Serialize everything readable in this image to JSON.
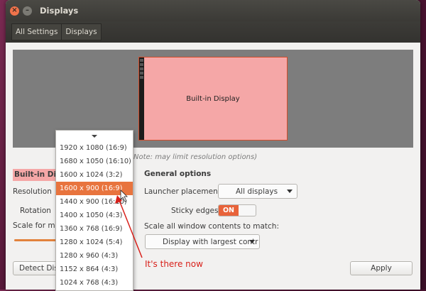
{
  "window": {
    "title": "Displays",
    "close_icon": "close-icon",
    "minimize_icon": "minimize-icon"
  },
  "toolbar": {
    "all_settings": "All Settings",
    "displays": "Displays"
  },
  "preview": {
    "monitor_label": "Built-in Display"
  },
  "note": "Note: may limit resolution options)",
  "left": {
    "display_name": "Built-in Display",
    "resolution_label": "Resolution",
    "rotation_label": "Rotation",
    "scale_label": "Scale for menu and title bars:",
    "detect_button": "Detect Displays"
  },
  "resolution_dropdown": {
    "options": [
      "1920 x 1080 (16:9)",
      "1680 x 1050 (16:10)",
      "1600 x 1024 (3:2)",
      "1600 x 900 (16:9)",
      "1440 x 900 (16:10)",
      "1400 x 1050 (4:3)",
      "1360 x 768 (16:9)",
      "1280 x 1024 (5:4)",
      "1280 x 960 (4:3)",
      "1152 x 864 (4:3)",
      "1024 x 768 (4:3)"
    ],
    "selected": "1600 x 900 (16:9)"
  },
  "general": {
    "title": "General options",
    "launcher_label": "Launcher placement",
    "launcher_value": "All displays",
    "sticky_label": "Sticky edges",
    "sticky_value": "ON",
    "scale_all_label": "Scale all window contents to match:",
    "scale_all_value": "Display with largest contr"
  },
  "apply_button": "Apply",
  "annotation": "It's there now",
  "colors": {
    "accent": "#e8633a",
    "monitor_fill": "#f5a7a7",
    "annotation": "#d8201a"
  }
}
